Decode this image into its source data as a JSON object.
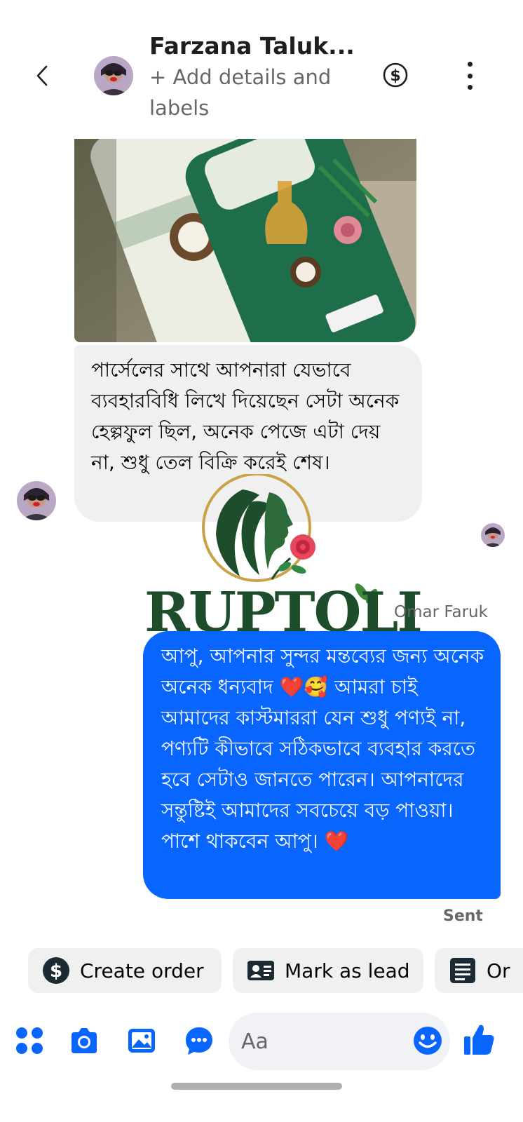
{
  "header": {
    "contact_name": "Farzana Taluk...",
    "subtitle": "+ Add details and labels",
    "back_icon": "chevron-left-icon",
    "payment_icon": "dollar-circle-icon",
    "more_icon": "more-vertical-icon"
  },
  "messages": {
    "incoming": {
      "text": "পার্সেলের সাথে আপনারা যেভাবে ব্যবহারবিধি লিখে দিয়েছেন সেটা অনেক হেল্পফুল ছিল, অনেক পেজে এটা দেয় না, শুধু তেল বিক্রি করেই শেষ।"
    },
    "outgoing": {
      "author": "Omar Faruk",
      "text": "আপু, আপনার সুন্দর মন্তব্যের জন্য অনেক অনেক ধন্যবাদ ❤️🥰 আমরা চাই আমাদের কাস্টমাররা যেন শুধু পণ্যই না, পণ্যটি কীভাবে সঠিকভাবে ব্যবহার করতে হবে সেটাও জানতে পারেন। আপনাদের সন্তুষ্টিই আমাদের সবচেয়ে বড় পাওয়া। পাশে থাকবেন আপু। ❤️",
      "status": "Sent"
    }
  },
  "logo": {
    "brand": "RUPTOLI"
  },
  "quick_actions": [
    {
      "label": "Create order",
      "icon": "dollar-circle-icon"
    },
    {
      "label": "Mark as lead",
      "icon": "contact-card-icon"
    },
    {
      "label": "Or",
      "icon": "list-document-icon"
    }
  ],
  "composer": {
    "placeholder": "Aa",
    "tools": [
      "apps-grid-icon",
      "camera-icon",
      "gallery-icon",
      "chat-bubble-icon"
    ],
    "emoji_icon": "smiley-icon",
    "like_icon": "thumbs-up-icon"
  },
  "colors": {
    "accent": "#0866ff",
    "bubble_incoming": "#f0f0f0",
    "brand_green": "#1d4d2b",
    "brand_gold": "#c9a24a"
  }
}
